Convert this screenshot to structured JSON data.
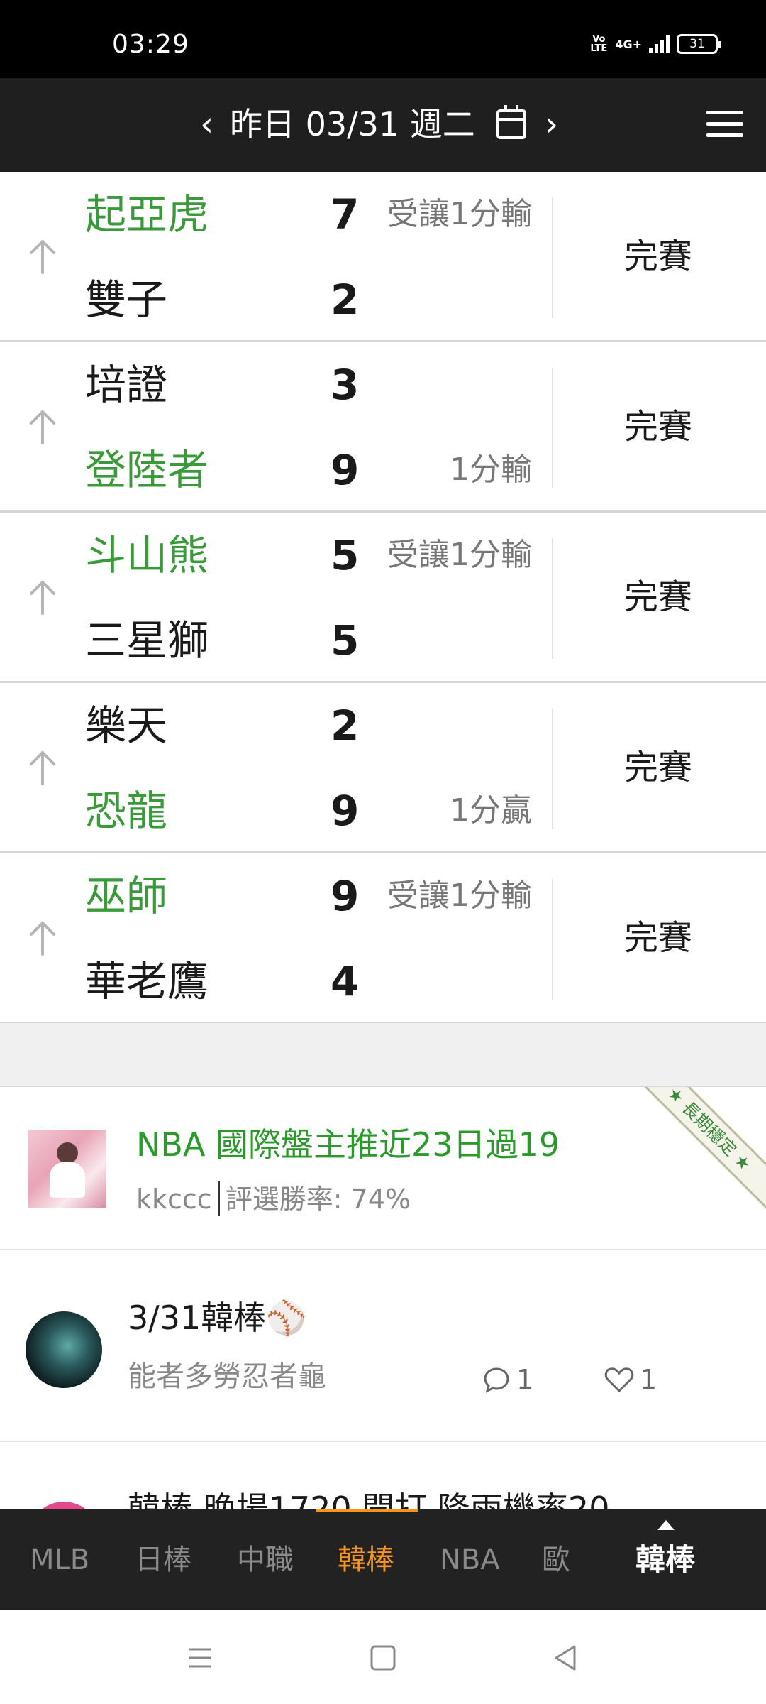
{
  "status_bar": {
    "time": "03:29",
    "volte": "Vo LTE",
    "network": "4G+",
    "battery": "31"
  },
  "header": {
    "prev_icon": "chevron-left-icon",
    "title": "昨日 03/31 週二",
    "calendar_icon": "calendar-icon",
    "next_icon": "chevron-right-icon",
    "menu_icon": "hamburger-menu-icon"
  },
  "games": [
    {
      "away": {
        "name": "起亞虎",
        "score": "7",
        "line": "受讓1分輸",
        "highlight": true
      },
      "home": {
        "name": "雙子",
        "score": "2",
        "line": "",
        "highlight": false
      },
      "status": "完賽"
    },
    {
      "away": {
        "name": "培證",
        "score": "3",
        "line": "",
        "highlight": false
      },
      "home": {
        "name": "登陸者",
        "score": "9",
        "line": "1分輸",
        "highlight": true
      },
      "status": "完賽"
    },
    {
      "away": {
        "name": "斗山熊",
        "score": "5",
        "line": "受讓1分輸",
        "highlight": true
      },
      "home": {
        "name": "三星獅",
        "score": "5",
        "line": "",
        "highlight": false
      },
      "status": "完賽"
    },
    {
      "away": {
        "name": "樂天",
        "score": "2",
        "line": "",
        "highlight": false
      },
      "home": {
        "name": "恐龍",
        "score": "9",
        "line": "1分贏",
        "highlight": true
      },
      "status": "完賽"
    },
    {
      "away": {
        "name": "巫師",
        "score": "9",
        "line": "受讓1分輸",
        "highlight": true
      },
      "home": {
        "name": "華老鷹",
        "score": "4",
        "line": "",
        "highlight": false
      },
      "status": "完賽"
    }
  ],
  "promo": {
    "title": "NBA 國際盤主推近23日過19",
    "user": "kkccc",
    "rate": "評選勝率: 74%",
    "ribbon": "長期穩定"
  },
  "post": {
    "title": "3/31韓棒⚾",
    "subtitle": "能者多勞忍者龜",
    "comments": "1",
    "likes": "1"
  },
  "post_peek": {
    "text": "韓棒  晚場1720 開打        降雨機率20"
  },
  "tabs": [
    {
      "label": "MLB",
      "active": false
    },
    {
      "label": "日棒",
      "active": false
    },
    {
      "label": "中職",
      "active": false
    },
    {
      "label": "韓棒",
      "active": true
    },
    {
      "label": "NBA",
      "active": false
    },
    {
      "label": "歐",
      "active": false
    }
  ],
  "current_tab": "韓棒",
  "colors": {
    "accent": "#f7941d",
    "team_highlight": "#3a9a3a",
    "header_bg": "#1f1f1f",
    "tabbar_bg": "#222222"
  }
}
